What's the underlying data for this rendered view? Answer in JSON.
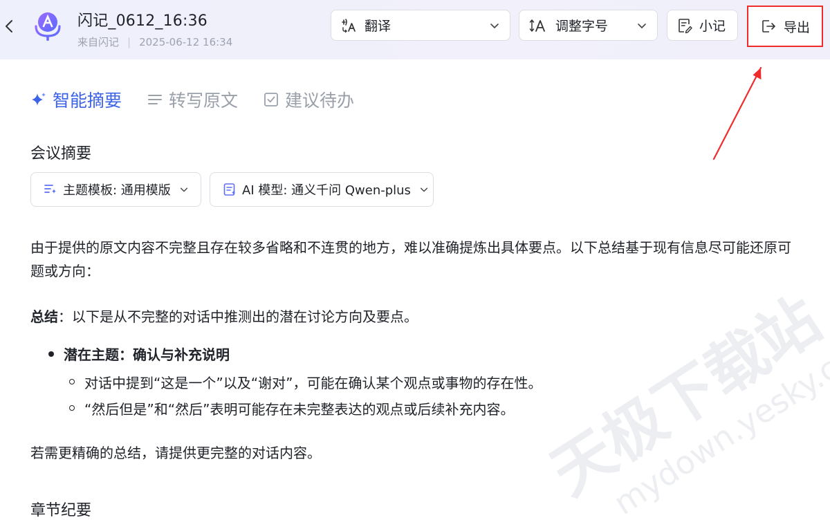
{
  "header": {
    "title": "闪记_0612_16:36",
    "source": "来自闪记",
    "separator": "|",
    "timestamp": "2025-06-12 16:34",
    "back_icon": "chevron-left-icon",
    "logo_icon": "voice-ai-logo"
  },
  "toolbar": {
    "translate_label": "翻译",
    "font_label": "调整字号",
    "note_label": "小记",
    "export_label": "导出"
  },
  "tabs": [
    {
      "label": "智能摘要",
      "icon": "sparkle-icon",
      "active": true
    },
    {
      "label": "转写原文",
      "icon": "lines-icon",
      "active": false
    },
    {
      "label": "建议待办",
      "icon": "checkbox-icon",
      "active": false
    }
  ],
  "summary": {
    "heading": "会议摘要",
    "template_chip": "主题模板: 通用模版",
    "model_chip": "AI 模型: 通义千问 Qwen-plus",
    "intro_line1": "由于提供的原文内容不完整且存在较多省略和不连贯的地方，难以准确提炼出具体要点。以下总结基于现有信息尽可能还原可",
    "intro_line2": "题或方向：",
    "summary_label": "总结",
    "summary_text": "：以下是从不完整的对话中推测出的潜在讨论方向及要点。",
    "bullet_title": "潜在主题：确认与补充说明",
    "sub_bullets": [
      "对话中提到“这是一个”以及“谢对”，可能在确认某个观点或事物的存在性。",
      "“然后但是”和“然后”表明可能存在未完整表达的观点或后续补充内容。"
    ],
    "closing": "若需更精确的总结，请提供更完整的对话内容。"
  },
  "chapters": {
    "heading": "章节纪要"
  },
  "watermark": {
    "text_cn": "天极下载站",
    "text_url": "mydown.yesky.com"
  },
  "colors": {
    "accent": "#3d63e6",
    "highlight": "#ef2b2b",
    "muted": "#9aa0a9"
  }
}
